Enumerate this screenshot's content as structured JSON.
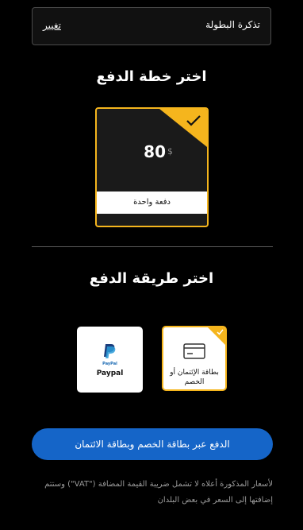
{
  "ticket": {
    "label": "تذكرة البطولة",
    "change_label": "تغيير"
  },
  "plan_section": {
    "title": "اختر خطة الدفع",
    "plans": [
      {
        "price": "80",
        "currency": "$",
        "label": "دفعة واحدة",
        "selected": true
      }
    ]
  },
  "method_section": {
    "title": "اختر طريقة الدفع",
    "methods": [
      {
        "label": "بطاقة الإئتمان أو الخصم",
        "icon": "credit-card-icon",
        "selected": true
      },
      {
        "label": "Paypal",
        "logo_text": "PayPal",
        "icon": "paypal-logo",
        "selected": false
      }
    ]
  },
  "pay_button": {
    "label": "الدفع عبر بطاقة الخصم وبطاقة الائتمان"
  },
  "vat_note": "لأسعار المذكورة أعلاه لا تشمل ضريبة القيمة المضافة (\"VAT\") وستتم إضافتها إلى السعر في بعض البلدان",
  "colors": {
    "background": "#000000",
    "accent": "#f5b51d",
    "button": "#1565c8",
    "paypal_blue": "#1a6ab3"
  }
}
